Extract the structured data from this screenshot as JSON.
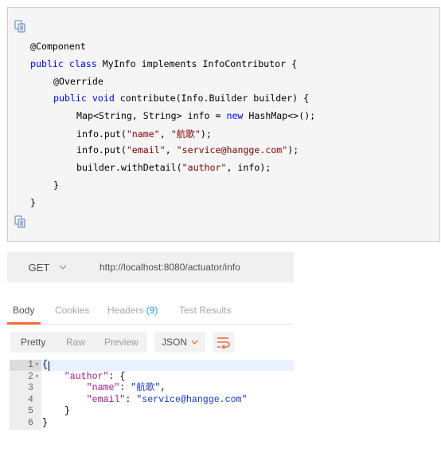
{
  "code": {
    "lines": [
      {
        "parts": [
          {
            "t": "@Component",
            "c": "ann"
          }
        ]
      },
      {
        "parts": [
          {
            "t": "public",
            "c": "kw"
          },
          {
            "t": " "
          },
          {
            "t": "class",
            "c": "kw"
          },
          {
            "t": " MyInfo implements InfoContributor {"
          }
        ]
      },
      {
        "parts": [
          {
            "t": "@Override",
            "c": "ann"
          }
        ]
      },
      {
        "parts": [
          {
            "t": "public",
            "c": "kw"
          },
          {
            "t": " "
          },
          {
            "t": "void",
            "c": "kw"
          },
          {
            "t": " contribute(Info.Builder builder) {"
          }
        ]
      },
      {
        "parts": [
          {
            "t": "Map<String, String> info = "
          },
          {
            "t": "new",
            "c": "kw"
          },
          {
            "t": " HashMap<>();"
          }
        ]
      },
      {
        "parts": [
          {
            "t": "info.put("
          },
          {
            "t": "\"name\"",
            "c": "str"
          },
          {
            "t": ", "
          },
          {
            "t": "\"航歌\"",
            "c": "str"
          },
          {
            "t": ");"
          }
        ]
      },
      {
        "parts": [
          {
            "t": "info.put("
          },
          {
            "t": "\"email\"",
            "c": "str"
          },
          {
            "t": ", "
          },
          {
            "t": "\"service@hangge.com\"",
            "c": "str"
          },
          {
            "t": ");"
          }
        ]
      },
      {
        "parts": [
          {
            "t": "builder.withDetail("
          },
          {
            "t": "\"author\"",
            "c": "str"
          },
          {
            "t": ", info);"
          }
        ]
      },
      {
        "parts": [
          {
            "t": "}"
          }
        ]
      },
      {
        "parts": [
          {
            "t": "}"
          }
        ]
      }
    ]
  },
  "request": {
    "method": "GET",
    "url": "http://localhost:8080/actuator/info"
  },
  "tabs": {
    "body": "Body",
    "cookies": "Cookies",
    "headers": "Headers",
    "headers_count": "(9)",
    "test_results": "Test Results"
  },
  "view": {
    "pretty": "Pretty",
    "raw": "Raw",
    "preview": "Preview",
    "format": "JSON"
  },
  "response": {
    "lines": [
      {
        "num": "1",
        "fold": "▾",
        "parts": [
          {
            "t": "{"
          }
        ]
      },
      {
        "num": "2",
        "fold": "▾",
        "parts": [
          {
            "t": "    "
          },
          {
            "t": "\"author\"",
            "c": "jkey"
          },
          {
            "t": ": {"
          }
        ]
      },
      {
        "num": "3",
        "fold": "",
        "parts": [
          {
            "t": "        "
          },
          {
            "t": "\"name\"",
            "c": "jkey"
          },
          {
            "t": ": "
          },
          {
            "t": "\"航歌\"",
            "c": "jstr"
          },
          {
            "t": ","
          }
        ]
      },
      {
        "num": "4",
        "fold": "",
        "parts": [
          {
            "t": "        "
          },
          {
            "t": "\"email\"",
            "c": "jkey"
          },
          {
            "t": ": "
          },
          {
            "t": "\"service@hangge.com\"",
            "c": "jstr"
          }
        ]
      },
      {
        "num": "5",
        "fold": "",
        "parts": [
          {
            "t": "    }"
          }
        ]
      },
      {
        "num": "6",
        "fold": "",
        "parts": [
          {
            "t": "}"
          }
        ]
      }
    ]
  },
  "icons": {
    "copy": "copy-icon",
    "wrap": "wrap-lines-icon",
    "chevron": "chevron-down-icon"
  },
  "colors": {
    "accent": "#f26b3a",
    "keyword": "#0000ff",
    "string": "#800000",
    "json_key": "#a11c86",
    "json_string": "#1a36c8",
    "count": "#26a0d8"
  }
}
